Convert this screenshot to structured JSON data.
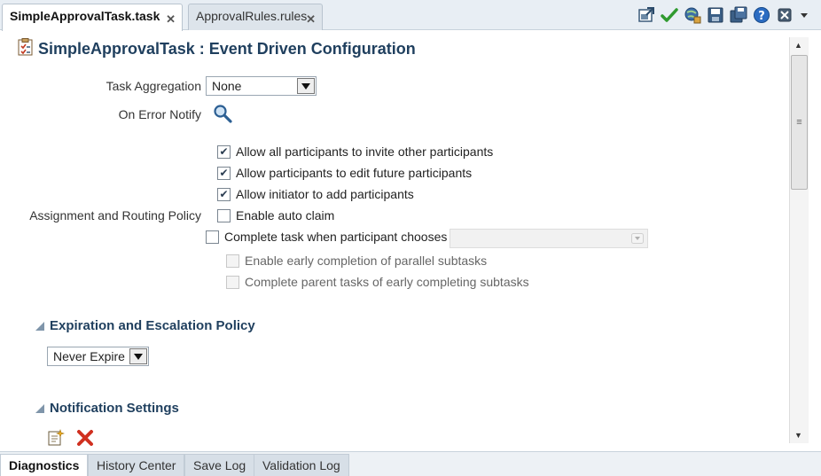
{
  "tabs": [
    {
      "label": "SimpleApprovalTask.task",
      "active": true
    },
    {
      "label": "ApprovalRules.rules",
      "active": false
    }
  ],
  "toolbar": {
    "icons": [
      "export-icon",
      "validate-check-icon",
      "deploy-globe-icon",
      "save-icon",
      "save-all-icon",
      "help-icon",
      "close-editor-icon",
      "overflow-menu-icon"
    ]
  },
  "page": {
    "title": "SimpleApprovalTask : Event Driven Configuration"
  },
  "form": {
    "task_aggregation_label": "Task Aggregation",
    "task_aggregation_value": "None",
    "on_error_notify_label": "On Error Notify",
    "assignment_policy_label": "Assignment and Routing Policy",
    "checkboxes": [
      {
        "label": "Allow all participants to invite other participants",
        "checked": true,
        "enabled": true
      },
      {
        "label": "Allow participants to edit future participants",
        "checked": true,
        "enabled": true
      },
      {
        "label": "Allow initiator to add participants",
        "checked": true,
        "enabled": true
      },
      {
        "label": "Enable auto claim",
        "checked": false,
        "enabled": true
      },
      {
        "label": "Complete task when participant chooses",
        "checked": false,
        "enabled": true
      },
      {
        "label": "Enable early completion of parallel subtasks",
        "checked": false,
        "enabled": false
      },
      {
        "label": "Complete parent tasks of early completing subtasks",
        "checked": false,
        "enabled": false
      }
    ],
    "participant_chooses_value": ""
  },
  "expiration": {
    "title": "Expiration and Escalation Policy",
    "value": "Never Expire"
  },
  "notification": {
    "title": "Notification Settings"
  },
  "bottom_tabs": [
    {
      "label": "Diagnostics",
      "active": true
    },
    {
      "label": "History Center",
      "active": false
    },
    {
      "label": "Save Log",
      "active": false
    },
    {
      "label": "Validation Log",
      "active": false
    }
  ]
}
